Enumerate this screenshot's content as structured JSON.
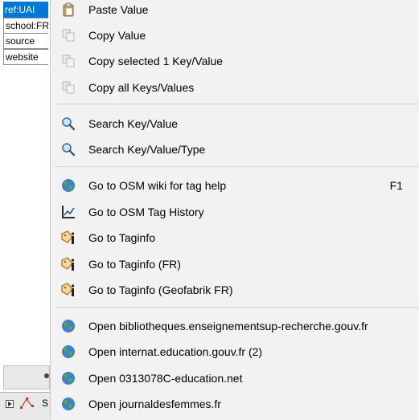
{
  "tag_table": {
    "rows": [
      "ref:UAI",
      "school:FR",
      "source",
      "website"
    ],
    "bottom_letter": "S"
  },
  "menu": {
    "clipboard": [
      {
        "label": "Paste Value",
        "icon": "paste-icon"
      },
      {
        "label": "Copy Value",
        "icon": "copy-icon"
      },
      {
        "label": "Copy selected 1 Key/Value",
        "icon": "copy-icon"
      },
      {
        "label": "Copy all Keys/Values",
        "icon": "copy-icon"
      }
    ],
    "search": [
      {
        "label": "Search Key/Value",
        "icon": "search-icon"
      },
      {
        "label": "Search Key/Value/Type",
        "icon": "search-icon"
      }
    ],
    "help": [
      {
        "label": "Go to OSM wiki for tag help",
        "icon": "globe-icon",
        "shortcut": "F1"
      },
      {
        "label": "Go to OSM Tag History",
        "icon": "chart-icon"
      },
      {
        "label": "Go to Taginfo",
        "icon": "taginfo-icon"
      },
      {
        "label": "Go to Taginfo (FR)",
        "icon": "taginfo-icon"
      },
      {
        "label": "Go to Taginfo (Geofabrik FR)",
        "icon": "taginfo-icon"
      }
    ],
    "links": [
      {
        "label": "Open bibliotheques.enseignementsup-recherche.gouv.fr",
        "icon": "globe-icon"
      },
      {
        "label": "Open internat.education.gouv.fr (2)",
        "icon": "globe-icon"
      },
      {
        "label": "Open 0313078C-education.net",
        "icon": "globe-icon"
      },
      {
        "label": "Open journaldesfemmes.fr",
        "icon": "globe-icon"
      }
    ]
  },
  "colors": {
    "selection": "#0078d7",
    "menu_background": "#f2f2f2",
    "separator": "#d6d6d6"
  }
}
